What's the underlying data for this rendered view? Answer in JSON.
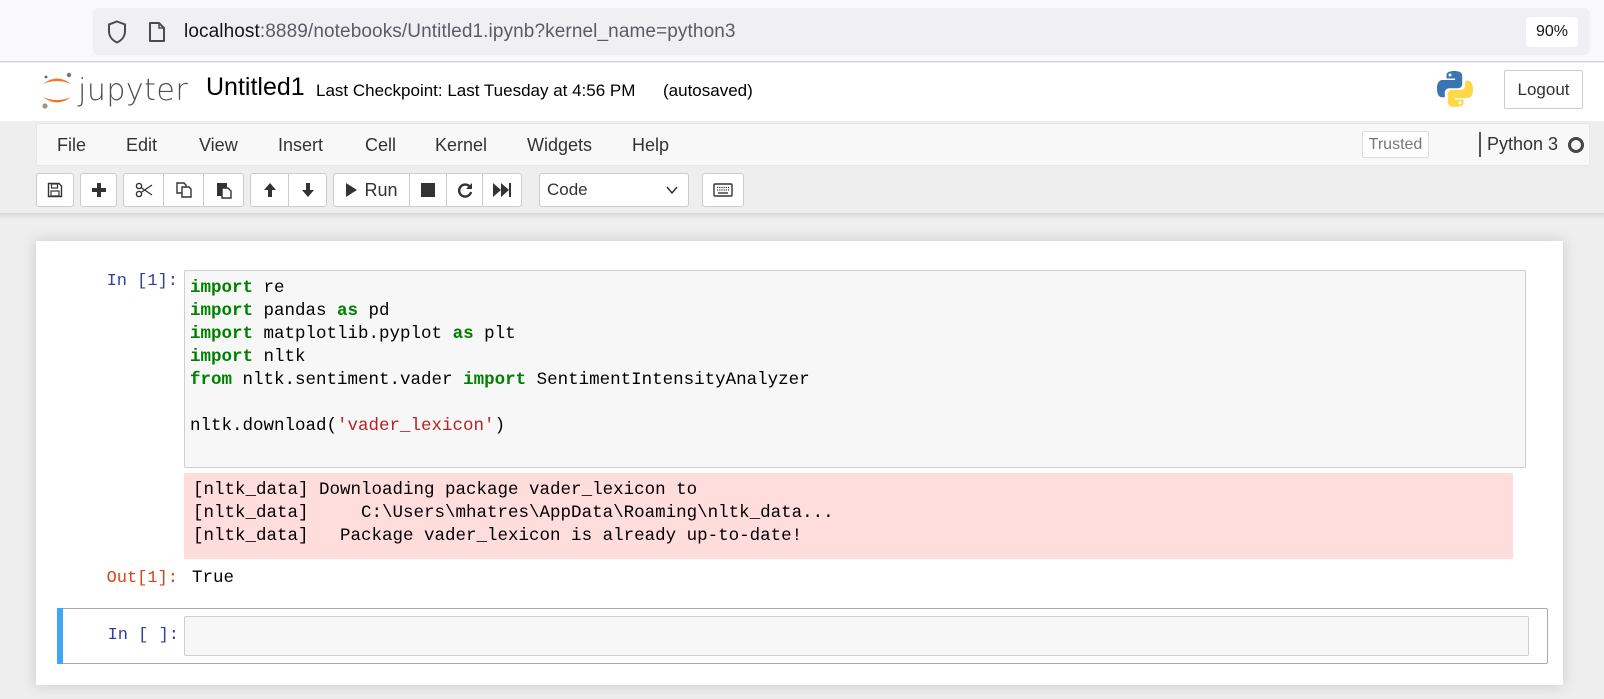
{
  "browser": {
    "url_host": "localhost",
    "url_rest": ":8889/notebooks/Untitled1.ipynb?kernel_name=python3",
    "zoom_level": "90%",
    "icons": [
      "shield-icon",
      "page-icon"
    ]
  },
  "header": {
    "logo_text": "jupyter",
    "notebook_title": "Untitled1",
    "checkpoint": "Last Checkpoint: Last Tuesday at 4:56 PM",
    "autosave_status": "(autosaved)",
    "logout_label": "Logout"
  },
  "menubar": {
    "items": [
      "File",
      "Edit",
      "View",
      "Insert",
      "Cell",
      "Kernel",
      "Widgets",
      "Help"
    ],
    "trusted_label": "Trusted",
    "kernel_name": "Python 3",
    "kernel_status": "idle"
  },
  "toolbar": {
    "buttons": [
      "save",
      "insert-cell-below",
      "cut",
      "copy",
      "paste",
      "move-up",
      "move-down",
      "run",
      "interrupt",
      "restart",
      "restart-run-all",
      "command-palette"
    ],
    "run_label": "Run",
    "cell_type": "Code"
  },
  "cells": [
    {
      "prompt": "In [1]:",
      "code_lines": [
        [
          {
            "t": "import",
            "k": "kw"
          },
          {
            "t": " re",
            "k": ""
          }
        ],
        [
          {
            "t": "import",
            "k": "kw"
          },
          {
            "t": " pandas ",
            "k": ""
          },
          {
            "t": "as",
            "k": "kw"
          },
          {
            "t": " pd",
            "k": ""
          }
        ],
        [
          {
            "t": "import",
            "k": "kw"
          },
          {
            "t": " matplotlib.pyplot ",
            "k": ""
          },
          {
            "t": "as",
            "k": "kw"
          },
          {
            "t": " plt",
            "k": ""
          }
        ],
        [
          {
            "t": "import",
            "k": "kw"
          },
          {
            "t": " nltk",
            "k": ""
          }
        ],
        [
          {
            "t": "from",
            "k": "kw"
          },
          {
            "t": " nltk.sentiment.vader ",
            "k": ""
          },
          {
            "t": "import",
            "k": "kw"
          },
          {
            "t": " SentimentIntensityAnalyzer",
            "k": ""
          }
        ],
        [
          {
            "t": "",
            "k": ""
          }
        ],
        [
          {
            "t": "nltk.download(",
            "k": ""
          },
          {
            "t": "'vader_lexicon'",
            "k": "str"
          },
          {
            "t": ")",
            "k": ""
          }
        ]
      ],
      "stderr": [
        "[nltk_data] Downloading package vader_lexicon to",
        "[nltk_data]     C:\\Users\\mhatres\\AppData\\Roaming\\nltk_data...",
        "[nltk_data]   Package vader_lexicon is already up-to-date!"
      ],
      "out_prompt": "Out[1]:",
      "out_value": "True"
    },
    {
      "prompt": "In [ ]:",
      "code": ""
    }
  ]
}
